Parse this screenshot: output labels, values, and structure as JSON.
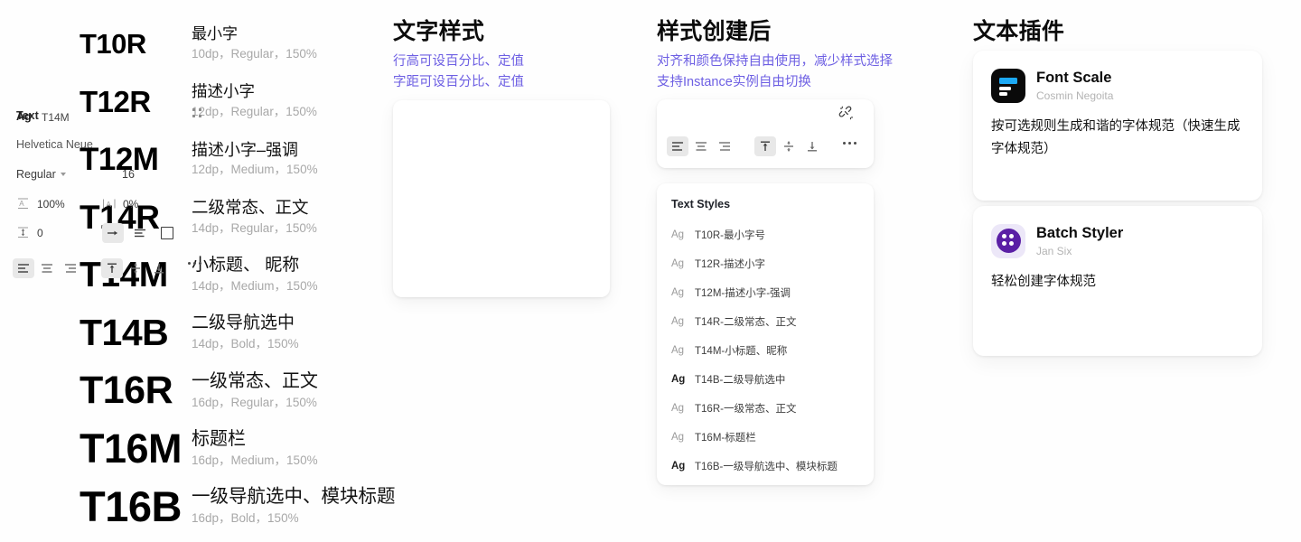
{
  "type_scale": {
    "rows": [
      {
        "token": "T10R",
        "name": "最小字",
        "spec": "10dp，Regular，150%"
      },
      {
        "token": "T12R",
        "name": "描述小字",
        "spec": "12dp，Regular，150%"
      },
      {
        "token": "T12M",
        "name": "描述小字–强调",
        "spec": "12dp，Medium，150%"
      },
      {
        "token": "T14R",
        "name": "二级常态、正文",
        "spec": "14dp，Regular，150%"
      },
      {
        "token": "T14M",
        "name": "小标题、 昵称",
        "spec": "14dp，Medium，150%"
      },
      {
        "token": "T14B",
        "name": "二级导航选中",
        "spec": "14dp，Bold，150%"
      },
      {
        "token": "T16R",
        "name": "一级常态、正文",
        "spec": "16dp，Regular，150%"
      },
      {
        "token": "T16M",
        "name": "标题栏",
        "spec": "16dp，Medium，150%"
      },
      {
        "token": "T16B",
        "name": "一级导航选中、模块标题",
        "spec": "16dp，Bold，150%"
      }
    ]
  },
  "section_text_style": {
    "title": "文字样式",
    "subtitle_line1": "行高可设百分比、定值",
    "subtitle_line2": "字距可设百分比、定值"
  },
  "section_after_create": {
    "title": "样式创建后",
    "subtitle_line1": "对齐和颜色保持自由使用，减少样式选择",
    "subtitle_line2": "支持Instance实例自由切换"
  },
  "section_plugins": {
    "title": "文本插件"
  },
  "text_panel": {
    "title": "Text",
    "font_family": "Helvetica Neue",
    "font_weight": "Regular",
    "font_size": "16",
    "line_height": "100%",
    "letter_spacing": "0%",
    "paragraph_spacing": "0",
    "align_options": [
      "align-left",
      "align-center",
      "align-right"
    ],
    "align_selected": "align-left",
    "valign_options": [
      "align-top",
      "align-middle",
      "align-bottom"
    ],
    "valign_selected": "align-top",
    "resize_options": [
      "auto-width",
      "auto-height",
      "fixed-size"
    ],
    "resize_selected": "auto-width",
    "more_label": "•••"
  },
  "style_bar": {
    "ag": "Ag",
    "style_name": "T14M",
    "detach_icon": "broken-link-icon",
    "align_selected": "align-left",
    "valign_selected": "align-top",
    "more_label": "•••"
  },
  "styles_list": {
    "heading": "Text Styles",
    "items": [
      {
        "ag": "Ag",
        "label": "T10R-最小字号",
        "bold": false
      },
      {
        "ag": "Ag",
        "label": "T12R-描述小字",
        "bold": false
      },
      {
        "ag": "Ag",
        "label": "T12M-描述小字-强调",
        "bold": false
      },
      {
        "ag": "Ag",
        "label": "T14R-二级常态、正文",
        "bold": false
      },
      {
        "ag": "Ag",
        "label": "T14M-小标题、昵称",
        "bold": false
      },
      {
        "ag": "Ag",
        "label": "T14B-二级导航选中",
        "bold": true
      },
      {
        "ag": "Ag",
        "label": "T16R-一级常态、正文",
        "bold": false
      },
      {
        "ag": "Ag",
        "label": "T16M-标题栏",
        "bold": false
      },
      {
        "ag": "Ag",
        "label": "T16B-一级导航选中、模块标题",
        "bold": true
      }
    ]
  },
  "plugins": {
    "font_scale": {
      "name": "Font Scale",
      "author": "Cosmin Negoita",
      "description": "按可选规则生成和谐的字体规范（快速生成字体规范）",
      "icon": "font-scale-icon"
    },
    "batch_styler": {
      "name": "Batch Styler",
      "author": "Jan Six",
      "description": "轻松创建字体规范",
      "icon": "batch-styler-icon"
    }
  },
  "colors": {
    "accent_purple": "#6d5fe3",
    "page_bg": "#fefefe",
    "card_bg": "#ffffff",
    "muted_text": "#a8a8a8",
    "font_scale_blue": "#1ca9f5",
    "batch_styler_purple": "#5a1fa5"
  }
}
